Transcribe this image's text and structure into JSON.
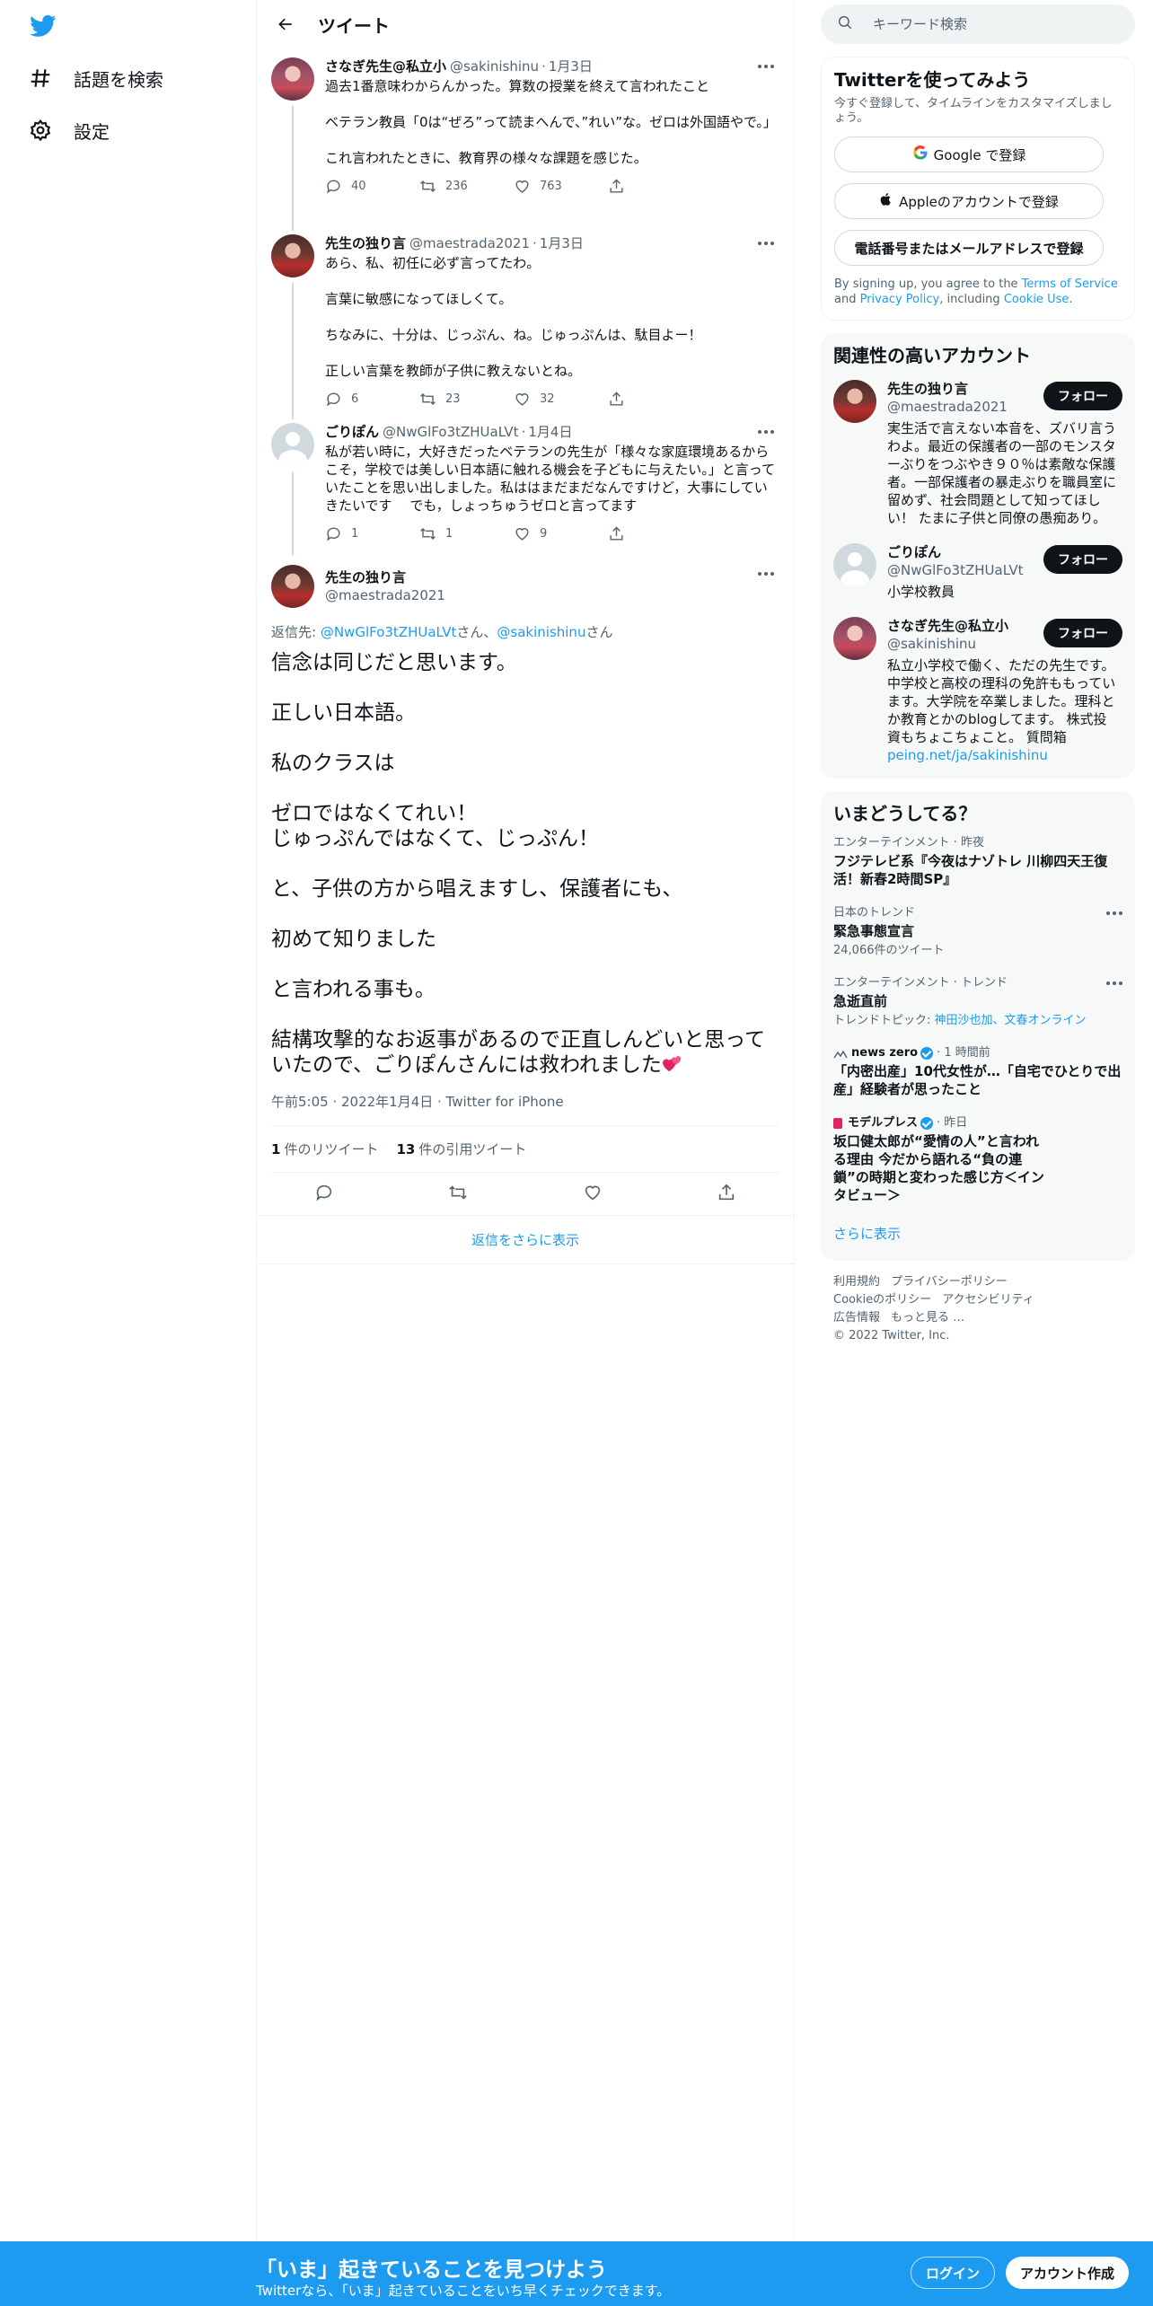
{
  "colors": {
    "accent": "#1d9bf0",
    "text": "#0f1419",
    "muted": "#536471",
    "heart": "#e0245e"
  },
  "nav": {
    "logo_icon": "twitter-bird-icon",
    "items": [
      {
        "icon": "hashtag-icon",
        "label": "話題を検索"
      },
      {
        "icon": "gear-icon",
        "label": "設定"
      }
    ]
  },
  "main": {
    "title": "ツイート",
    "tweets": [
      {
        "name": "さなぎ先生@私立小",
        "handle": "@sakinishinu",
        "date": "1月3日",
        "text": "過去1番意味わからんかった。算数の授業を終えて言われたこと\n\nベテラン教員「0は“ぜろ”って読まへんで、”れい”な。ゼロは外国語やで。」\n\nこれ言われたときに、教育界の様々な課題を感じた。",
        "replies": "40",
        "retweets": "236",
        "likes": "763"
      },
      {
        "name": "先生の独り言",
        "handle": "@maestrada2021",
        "date": "1月3日",
        "text": "あら、私、初任に必ず言ってたわ。\n\n言葉に敏感になってほしくて。\n\nちなみに、十分は、じっぷん、ね。じゅっぷんは、駄目よー！\n\n正しい言葉を教師が子供に教えないとね。",
        "replies": "6",
        "retweets": "23",
        "likes": "32"
      },
      {
        "name": "ごりぽん",
        "handle": "@NwGlFo3tZHUaLVt",
        "date": "1月4日",
        "text": "私が若い時に，大好きだったベテランの先生が「様々な家庭環境あるからこそ，学校では美しい日本語に触れる機会を子どもに与えたい。」と言っていたことを思い出しました。私ははまだまだなんですけど，大事にしていきたいです　 でも，しょっちゅうゼロと言ってます",
        "replies": "1",
        "retweets": "1",
        "likes": "9"
      }
    ],
    "focus": {
      "name": "先生の独り言",
      "handle": "@maestrada2021",
      "reply_prefix": "返信先: ",
      "reply_to_1": "@NwGlFo3tZHUaLVt",
      "reply_mid": "さん、",
      "reply_to_2": "@sakinishinu",
      "reply_suffix": "さん",
      "text": "信念は同じだと思います。\n\n正しい日本語。\n\n私のクラスは\n\nゼロではなくてれい！\nじゅっぷんではなくて、じっぷん！\n\nと、子供の方から唱えますし、保護者にも、\n\n初めて知りました\n\nと言われる事も。\n\n結構攻撃的なお返事があるので正直しんどいと思っていたので、ごりぽんさんには救われました",
      "emoji": "two-hearts-icon",
      "timestamp": "午前5:05 · 2022年1月4日 · Twitter for iPhone",
      "retweet_count": "1",
      "retweet_label": "件のリツイート",
      "quote_count": "13",
      "quote_label": "件の引用ツイート"
    },
    "show_more_replies": "返信をさらに表示"
  },
  "sidebar": {
    "search_placeholder": "キーワード検索",
    "signup": {
      "title": "Twitterを使ってみよう",
      "subtitle": "今すぐ登録して、タイムラインをカスタマイズしましょう。",
      "google_btn": "Google で登録",
      "apple_btn": "Appleのアカウントで登録",
      "phone_btn": "電話番号またはメールアドレスで登録",
      "terms_1": "By signing up, you agree to the ",
      "terms_link_1": "Terms of Service",
      "terms_2": " and ",
      "terms_link_2": "Privacy Policy",
      "terms_3": ", including ",
      "terms_link_3": "Cookie Use",
      "terms_4": "."
    },
    "related": {
      "title": "関連性の高いアカウント",
      "follow_label": "フォロー",
      "accounts": [
        {
          "name": "先生の独り言",
          "handle": "@maestrada2021",
          "bio": "実生活で言えない本音を、ズバリ言うわよ。最近の保護者の一部のモンスターぶりをつぶやき９０％は素敵な保護者。一部保護者の暴走ぶりを職員室に留めず、社会問題として知ってほしい！ たまに子供と同僚の愚痴あり。"
        },
        {
          "name": "ごりぽん",
          "handle": "@NwGlFo3tZHUaLVt",
          "bio": "小学校教員"
        },
        {
          "name": "さなぎ先生@私立小",
          "handle": "@sakinishinu",
          "bio": "私立小学校で働く、ただの先生です。中学校と高校の理科の免許ももっています。大学院を卒業しました。理科とか教育とかのblogしてます。 株式投資もちょこちょこと。 質問箱",
          "bio_link": "peing.net/ja/sakinishinu"
        }
      ]
    },
    "trends": {
      "title": "いまどうしてる？",
      "items": [
        {
          "meta": "エンターテインメント · 昨夜",
          "title": "フジテレビ系『今夜はナゾトレ 川柳四天王復活！新春2時間SP』"
        },
        {
          "meta": "日本のトレンド",
          "title": "緊急事態宣言",
          "sub": "24,066件のツイート"
        },
        {
          "meta": "エンターテインメント · トレンド",
          "title": "急逝直前",
          "sub_prefix": "トレンドトピック: ",
          "sub_link": "神田沙也加、文春オンライン"
        },
        {
          "source": "news zero",
          "time": "· 1 時間前",
          "title": "「内密出産」10代女性が…「自宅でひとりで出産」経験者が思ったこと"
        },
        {
          "source": "モデルプレス",
          "time": "· 昨日",
          "title": "坂口健太郎が“愛情の人”と言われる理由 今だから語れる“負の連鎖”の時期と変わった感じ方＜インタビュー＞"
        }
      ],
      "show_more": "さらに表示"
    },
    "footer": [
      "利用規約",
      "プライバシーポリシー",
      "Cookieのポリシー",
      "アクセシビリティ",
      "広告情報",
      "もっと見る …",
      "© 2022 Twitter, Inc."
    ]
  },
  "bottombar": {
    "title": "「いま」起きていることを見つけよう",
    "subtitle": "Twitterなら、「いま」起きていることをいち早くチェックできます。",
    "login": "ログイン",
    "signup": "アカウント作成"
  }
}
